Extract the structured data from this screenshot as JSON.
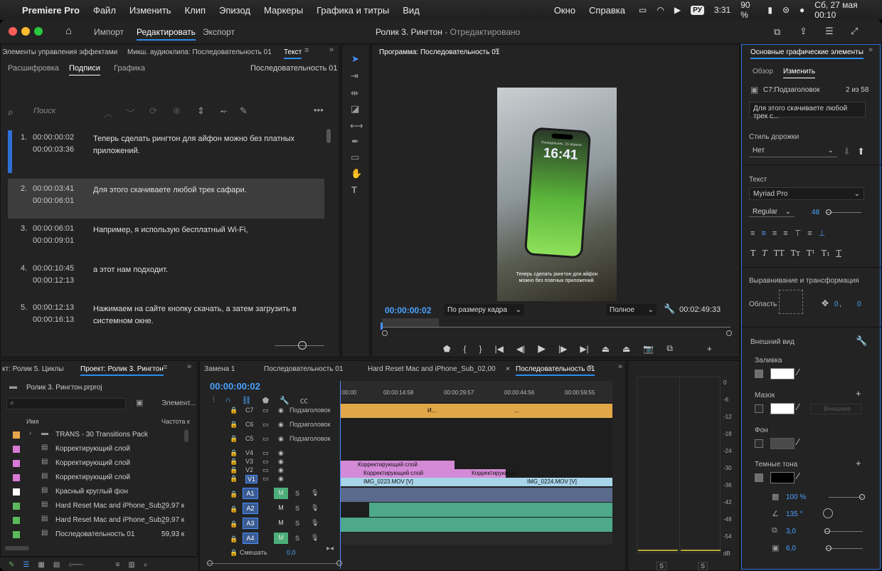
{
  "menubar": {
    "apple": "",
    "app": "Premiere Pro",
    "items": [
      "Файл",
      "Изменить",
      "Клип",
      "Эпизод",
      "Маркеры",
      "Графика и титры",
      "Вид",
      "Окно",
      "Справка"
    ],
    "lang": "РУ",
    "time_left": "3:31",
    "battery": "90 %",
    "datetime": "Сб, 27 мая  00:10"
  },
  "titlebar": {
    "tabs": [
      "Импорт",
      "Редактировать",
      "Экспорт"
    ],
    "title": "Ролик 3. Рингтон",
    "title_state": " - Отредактировано"
  },
  "left_panel": {
    "tabs": [
      "Элементы управления эффектами",
      "Микш. аудиоклипа: Последовательность 01",
      "Текст"
    ],
    "subtabs": [
      "Расшифровка",
      "Подписи",
      "Графика"
    ],
    "sequence": "Последовательность 01",
    "search_placeholder": "Поиск"
  },
  "captions": [
    {
      "n": "1.",
      "in": "00:00:00:02",
      "out": "00:00:03:36",
      "text": "Теперь сделать рингтон для айфон можно без платных приложений."
    },
    {
      "n": "2.",
      "in": "00:00:03:41",
      "out": "00:00:06:01",
      "text": "Для этого скачиваете любой трек сафари."
    },
    {
      "n": "3.",
      "in": "00:00:06:01",
      "out": "00:00:09:01",
      "text": "Например, я использую бесплатный Wi-Fi,"
    },
    {
      "n": "4.",
      "in": "00:00:10:45",
      "out": "00:00:12:13",
      "text": "а этот нам подходит."
    },
    {
      "n": "5.",
      "in": "00:00:12:13",
      "out": "00:00:16:13",
      "text": "Нажимаем на сайте кнопку скачать, а затем загрузить в системном окне."
    }
  ],
  "program": {
    "title": "Программа: Последовательность 01",
    "phone_time": "16:41",
    "phone_date": "Понедельник, 15 апреля",
    "subtitle_line1": "Теперь сделать рингтон для айфон",
    "subtitle_line2": "можно без платных приложений.",
    "timecode": "00:00:00:02",
    "fit": "По размеру кадра",
    "quality": "Полное",
    "duration": "00:02:49:33"
  },
  "project": {
    "tabs": [
      "кт: Ролик 5. Циклы",
      "Проект: Ролик 3. Рингтон"
    ],
    "file": "Ролик 3. Рингтон.prproj",
    "elements": "Элемент...",
    "col_name": "Имя",
    "col_rate": "Частота к",
    "items": [
      {
        "name": "TRANS - 30 Transitions Pack",
        "rate": "",
        "color": "#e8a44a",
        "folder": true
      },
      {
        "name": "Корректирующий слой",
        "rate": "",
        "color": "#d67ad6"
      },
      {
        "name": "Корректирующий слой",
        "rate": "",
        "color": "#d67ad6"
      },
      {
        "name": "Корректирующий слой",
        "rate": "",
        "color": "#d67ad6"
      },
      {
        "name": "Красный круглый фон",
        "rate": "",
        "color": "#ffffff"
      },
      {
        "name": "Hard Reset Mac and iPhone_Sub_",
        "rate": "29,97 к",
        "color": "#5cb85c"
      },
      {
        "name": "Hard Reset Mac and iPhone_Sub_",
        "rate": "29,97 к",
        "color": "#5cb85c"
      },
      {
        "name": "Последовательность 01",
        "rate": "59,93 к",
        "color": "#5cb85c"
      }
    ]
  },
  "timeline": {
    "tabs": [
      "Замена 1",
      "Последовательность 01",
      "Hard Reset Mac and iPhone_Sub_02,00",
      "Последовательность 01"
    ],
    "timecode": "00:00:00:02",
    "ruler": [
      ":00:00",
      "00:00:14:58",
      "00:00:29:57",
      "00:00:44:56",
      "00:00:59:55"
    ],
    "caption_tracks": [
      {
        "id": "C7",
        "name": "Подзаголовок"
      },
      {
        "id": "C6",
        "name": "Подзаголовок"
      },
      {
        "id": "C5",
        "name": "Подзаголовок"
      }
    ],
    "video_tracks": [
      "V4",
      "V3",
      "V2",
      "V1"
    ],
    "audio_tracks": [
      "A1",
      "A2",
      "A3",
      "A4"
    ],
    "mix_label": "Смешать",
    "mix_value": "0,0",
    "clips": {
      "adj1": "Корректирующий слой",
      "adj2": "Корректирующий слой",
      "adj3": "Корректирующий",
      "v1a": "IMG_0223.MOV [V]",
      "v1b": "IMG_0224.MOV [V]",
      "c7a": "И...",
      "c7b": "..."
    }
  },
  "meter": {
    "scale": [
      "0",
      "-6",
      "-12",
      "-18",
      "-24",
      "-30",
      "-36",
      "-42",
      "-48",
      "-54",
      "dB"
    ],
    "s_labels": [
      "S",
      "S"
    ]
  },
  "egp": {
    "title": "Основные графические элементы",
    "tabs": [
      "Обзор",
      "Изменить"
    ],
    "layer": "C7:Подзаголовок",
    "count": "2 из 58",
    "caption_text": "Для этого скачиваете любой трек с...",
    "track_style_label": "Стиль дорожки",
    "track_style": "Нет",
    "text_label": "Текст",
    "font": "Myriad Pro",
    "font_style": "Regular",
    "font_size": "48",
    "align_label": "Выравнивание и трансформация",
    "area_label": "Область",
    "pos_x": "0",
    "pos_y": "0",
    "appearance": "Внешний вид",
    "fill": "Заливка",
    "stroke": "Мазок",
    "stroke_type": "Внешнее",
    "background": "Фон",
    "shadow": "Темные тона",
    "opacity": "100 %",
    "angle": "135 °",
    "distance": "3,0",
    "size": "6,0"
  }
}
